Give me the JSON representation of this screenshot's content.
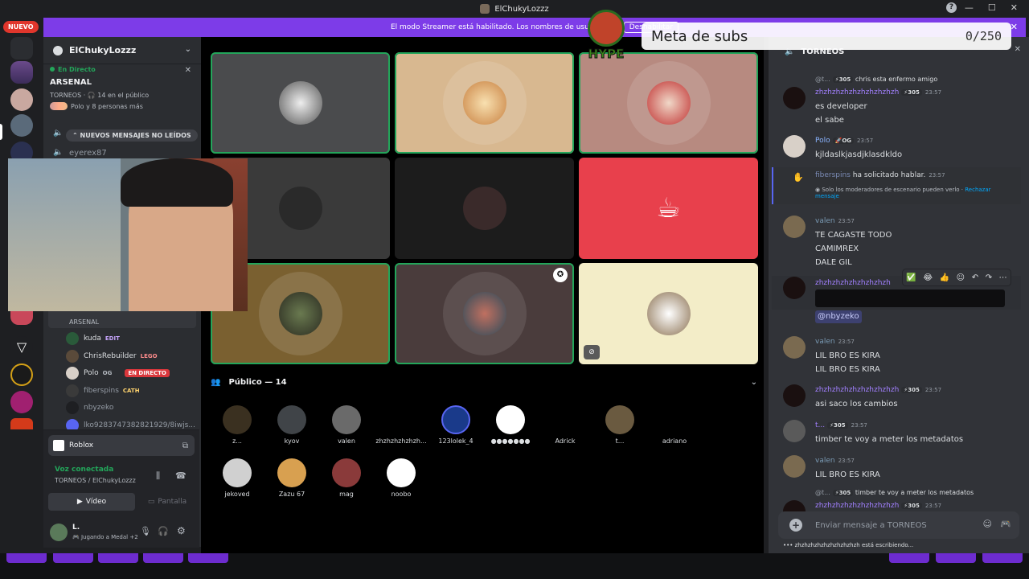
{
  "window": {
    "title": "ElChukyLozzz"
  },
  "banner": {
    "text": "El modo Streamer está habilitado. Los nombres de usuario se h",
    "button": "Deshabilitar",
    "new_badge": "NUEVO"
  },
  "server": {
    "name": "ElChukyLozzz",
    "live_label": "En Directo",
    "stage_name": "ARSENAL",
    "stage_meta": "TORNEOS · 🎧 14 en el público",
    "stage_people": "Polo y 8 personas más",
    "new_messages": "NUEVOS MENSAJES NO LEÍDOS",
    "channel_user": "eyerex87",
    "voice_sub": "ARSENAL"
  },
  "voice_users": [
    {
      "name": "kuda",
      "badge": "EDIT",
      "badge_color": "#c8a6ff"
    },
    {
      "name": "ChrisRebuilder",
      "badge": "LEGO",
      "badge_color": "#ff8c8c"
    },
    {
      "name": "Polo",
      "badge": "OG",
      "badge_color": "#b5bac1",
      "live": "EN DIRECTO"
    },
    {
      "name": "fiberspins",
      "badge": "CATH",
      "badge_color": "#ffd36e"
    },
    {
      "name": "nbyzeko",
      "badge": "",
      "badge_color": ""
    },
    {
      "name": "lko92837473828219​29/8iwjs...",
      "badge": "",
      "badge_color": ""
    }
  ],
  "activity": {
    "name": "Roblox"
  },
  "voice_panel": {
    "status": "Voz conectada",
    "channel": "TORNEOS / ElChukyLozzz",
    "video": "Vídeo",
    "screen": "Pantalla",
    "user": "L.",
    "user_status": "Jugando a Medal",
    "user_status_extra": "+2"
  },
  "audience": {
    "title": "Público — 14",
    "members": [
      "z...",
      "kyov",
      "valen",
      "zhzhzhzhzhzh...",
      "123lolek_4",
      "●●●●●●●",
      "Adrick",
      "t...",
      "adriano",
      "jekoved",
      "Zazu 67",
      "mag",
      "noobo"
    ]
  },
  "overlay": {
    "goal_label": "Meta de subs",
    "goal_value": "0/250",
    "mascot_text": "HYPE"
  },
  "chat": {
    "channel": "TORNEOS",
    "placeholder": "Enviar mensaje a TORNEOS",
    "typing": "zhzhzhzhzhzhzhzhzhzh está escribiendo...",
    "messages": [
      {
        "reply_user": "@t...",
        "reply_boost": "305",
        "reply_text": "chris esta enfermo amigo",
        "user": "zhzhzhzhzhzhzhzhzhzh",
        "boost": "305",
        "time": "23:57",
        "lines": [
          "es developer",
          "el sabe"
        ]
      },
      {
        "user": "Polo",
        "badge": "OG",
        "time": "23:57",
        "lines": [
          "kjldaslkjasdjklasdkldo"
        ]
      },
      {
        "user": "fiberspins",
        "system": "ha solicitado hablar.",
        "time": "23:57",
        "note": "Solo los moderadores de escenario pueden verlo ·",
        "note_link": "Rechazar",
        "note_link2": "mensaje"
      },
      {
        "user": "valen",
        "time": "23:57",
        "lines": [
          "TE CAGASTE TODO",
          "CAMIMREX",
          "DALE GIL"
        ]
      },
      {
        "user": "zhzhzhzhzhzhzhzhzh",
        "mention": "@nbyzeko"
      },
      {
        "user": "valen",
        "time": "23:57",
        "lines": [
          "LIL BRO ES KIRA",
          "LIL BRO ES KIRA"
        ]
      },
      {
        "user": "zhzhzhzhzhzhzhzhzhzh",
        "boost": "305",
        "time": "23:57",
        "lines": [
          "asi saco los cambios"
        ]
      },
      {
        "user": "t...",
        "boost": "305",
        "time": "23:57",
        "lines": [
          "timber te voy a meter los metadatos"
        ]
      },
      {
        "user": "valen",
        "time": "23:57",
        "lines": [
          "LIL BRO ES KIRA"
        ]
      },
      {
        "reply_user": "@t...",
        "reply_boost": "305",
        "reply_text": "timber te voy a meter los metadatos",
        "user": "zhzhzhzhzhzhzhzhzhzh",
        "boost": "305",
        "time": "23:57"
      }
    ]
  },
  "colors": {
    "accent": "#7d3ce8",
    "speaking": "#23a55a",
    "live": "#da373c",
    "link": "#00a8fc"
  }
}
